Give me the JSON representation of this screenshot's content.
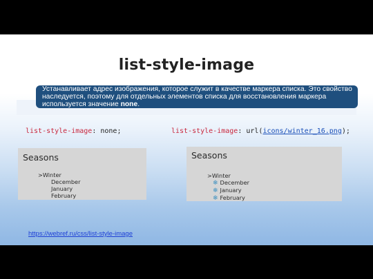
{
  "slide": {
    "title": "list-style-image",
    "description_main": "Устанавливает адрес изображения, которое служит в качестве маркера списка. Это свойство наследуется, поэтому для отдельных элементов списка для восстановления маркера используется значение ",
    "description_keyword": "none",
    "description_end": "."
  },
  "examples": {
    "left": {
      "property": "list-style-image",
      "separator": ": ",
      "value": "none",
      "end": ";"
    },
    "right": {
      "property": "list-style-image",
      "separator": ": url(",
      "value": "icons/winter_16.png",
      "end": ");"
    }
  },
  "demos": {
    "left": {
      "heading": "Seasons",
      "parent": ">Winter",
      "items": [
        "December",
        "January",
        "February"
      ]
    },
    "right": {
      "heading": "Seasons",
      "parent": ">Winter",
      "items": [
        "December",
        "January",
        "February"
      ],
      "marker_icon": "snowflake-icon"
    }
  },
  "link": {
    "text": "https://webref.ru/css/list-style-image"
  },
  "colors": {
    "description_bg": "#1f4f7e",
    "link": "#1d3fd6"
  }
}
